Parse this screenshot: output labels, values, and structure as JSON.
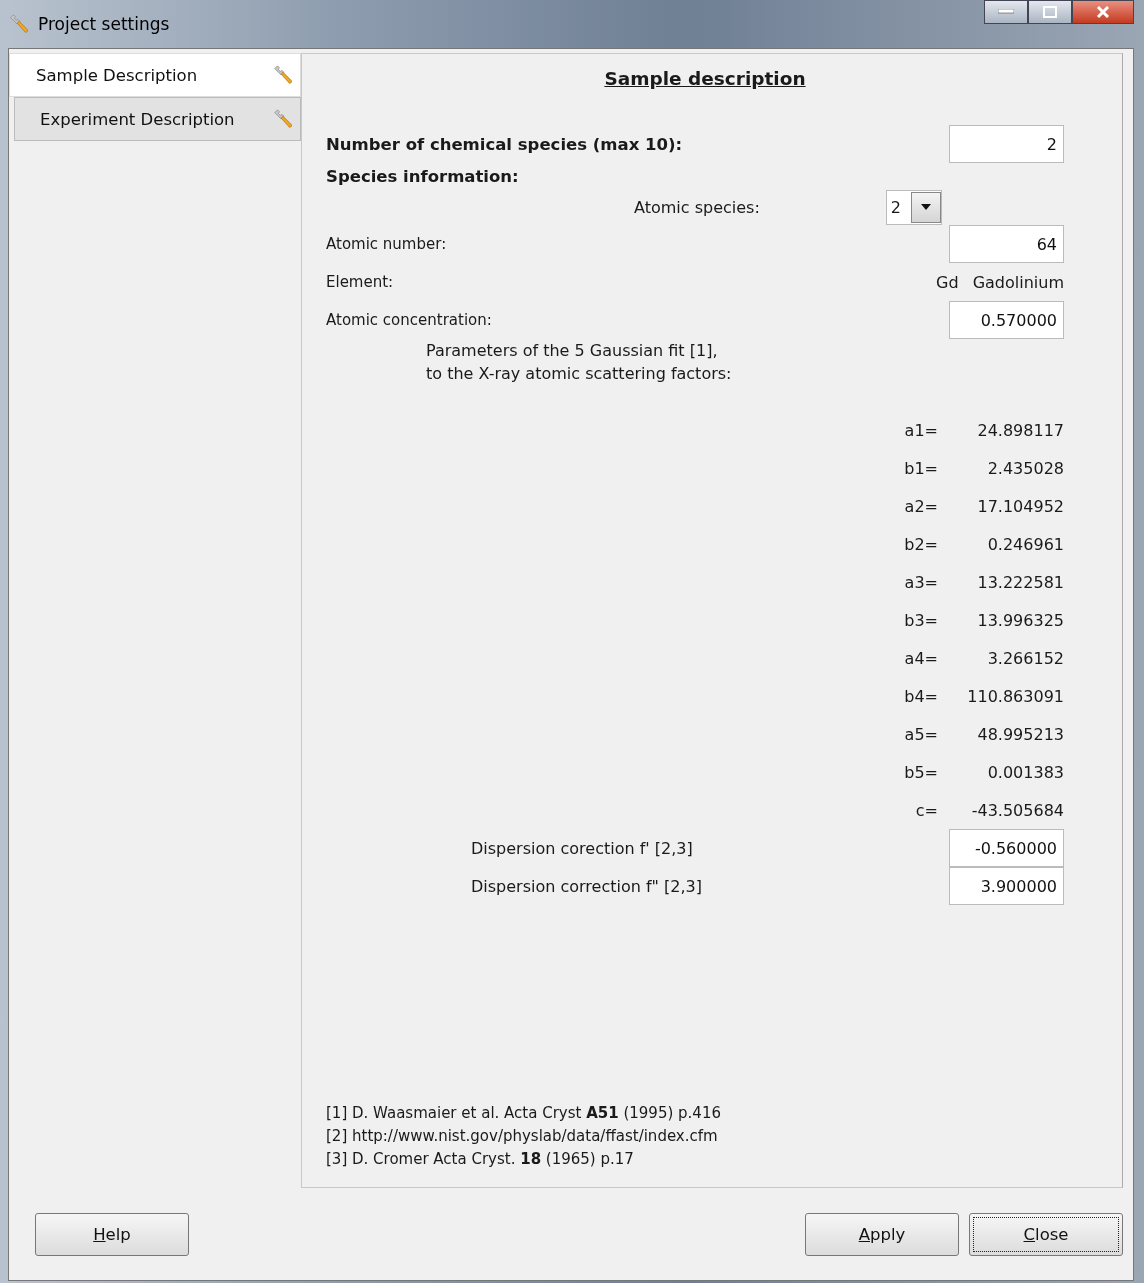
{
  "window": {
    "title": "Project settings"
  },
  "tabs": [
    {
      "label": "Sample Description",
      "selected": true
    },
    {
      "label": "Experiment Description",
      "selected": false
    }
  ],
  "panel": {
    "title": "Sample description",
    "species_count": {
      "label": "Number of chemical species (max 10):",
      "value": "2"
    },
    "species_heading": "Species information:",
    "atomic_species": {
      "label": "Atomic species:",
      "value": "2"
    },
    "atomic_number": {
      "label": "Atomic number:",
      "value": "64"
    },
    "element": {
      "label": "Element:",
      "symbol": "Gd",
      "name": "Gadolinium"
    },
    "concentration": {
      "label": "Atomic concentration:",
      "value": "0.570000"
    },
    "fit_note": [
      "Parameters of the 5 Gaussian fit [1],",
      "to the X-ray atomic scattering factors:"
    ],
    "parameters": [
      {
        "label": "a1=",
        "value": "24.898117"
      },
      {
        "label": "b1=",
        "value": "2.435028"
      },
      {
        "label": "a2=",
        "value": "17.104952"
      },
      {
        "label": "b2=",
        "value": "0.246961"
      },
      {
        "label": "a3=",
        "value": "13.222581"
      },
      {
        "label": "b3=",
        "value": "13.996325"
      },
      {
        "label": "a4=",
        "value": "3.266152"
      },
      {
        "label": "b4=",
        "value": "110.863091"
      },
      {
        "label": "a5=",
        "value": "48.995213"
      },
      {
        "label": "b5=",
        "value": "0.001383"
      },
      {
        "label": "c=",
        "value": "-43.505684"
      }
    ],
    "dispersion": [
      {
        "label": "Dispersion corection f' [2,3]",
        "value": "-0.560000"
      },
      {
        "label": "Dispersion correction f\" [2,3]",
        "value": "3.900000"
      }
    ],
    "references": [
      "[1] D. Waasmaier et al. Acta Cryst **A51** (1995) p.416",
      "[2] http://www.nist.gov/physlab/data/ffast/index.cfm",
      "[3] D. Cromer Acta Cryst. **18** (1965) p.17"
    ]
  },
  "buttons": [
    {
      "mnemonic": "H",
      "rest": "elp",
      "focused": false
    },
    {
      "mnemonic": "A",
      "rest": "pply",
      "focused": false
    },
    {
      "mnemonic": "C",
      "rest": "lose",
      "focused": true
    }
  ]
}
